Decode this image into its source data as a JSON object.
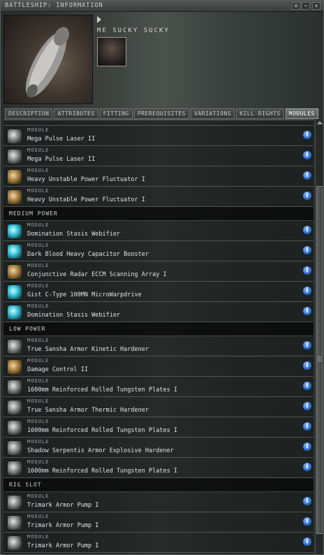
{
  "window": {
    "title": "BATTLESHIP: INFORMATION",
    "buttons": [
      "⊙",
      "−",
      "×"
    ]
  },
  "header": {
    "pilot_name": "ME SUCKY SUCKY"
  },
  "tabs": [
    {
      "label": "DESCRIPTION",
      "active": false
    },
    {
      "label": "ATTRIBUTES",
      "active": false
    },
    {
      "label": "FITTING",
      "active": false
    },
    {
      "label": "PREREQUISITES",
      "active": false
    },
    {
      "label": "VARIATIONS",
      "active": false
    },
    {
      "label": "KILL RIGHTS",
      "active": false
    },
    {
      "label": "MODULES",
      "active": true
    }
  ],
  "modules": {
    "kind_label": "MODULE",
    "info_glyph": "i",
    "high_power": [
      {
        "name": "Mega Pulse Laser II",
        "icon": "laser-icon"
      },
      {
        "name": "Mega Pulse Laser II",
        "icon": "laser-icon"
      },
      {
        "name": "Heavy Unstable Power Fluctuator I",
        "icon": "neut-icon"
      },
      {
        "name": "Heavy Unstable Power Fluctuator I",
        "icon": "neut-icon"
      }
    ],
    "medium_power_label": "MEDIUM POWER",
    "medium_power": [
      {
        "name": "Domination Stasis Webifier",
        "icon": "web-icon"
      },
      {
        "name": "Dark Blood Heavy Capacitor Booster",
        "icon": "capacitor-booster-icon"
      },
      {
        "name": "Conjunctive Radar ECCM Scanning Array I",
        "icon": "eccm-icon"
      },
      {
        "name": "Gist C-Type 100MN MicroWarpdrive",
        "icon": "mwd-icon"
      },
      {
        "name": "Domination Stasis Webifier",
        "icon": "web-icon"
      }
    ],
    "low_power_label": "LOW POWER",
    "low_power": [
      {
        "name": "True Sansha Armor Kinetic Hardener",
        "icon": "hardener-icon"
      },
      {
        "name": "Damage Control II",
        "icon": "damage-control-icon"
      },
      {
        "name": "1600mm Reinforced Rolled Tungsten Plates I",
        "icon": "armor-plate-icon"
      },
      {
        "name": "True Sansha Armor Thermic Hardener",
        "icon": "hardener-icon"
      },
      {
        "name": "1600mm Reinforced Rolled Tungsten Plates I",
        "icon": "armor-plate-icon"
      },
      {
        "name": "Shadow Serpentis Armor Explosive Hardener",
        "icon": "hardener-icon"
      },
      {
        "name": "1600mm Reinforced Rolled Tungsten Plates I",
        "icon": "armor-plate-icon"
      }
    ],
    "rig_slot_label": "RIG SLOT",
    "rig_slot": [
      {
        "name": "Trimark Armor Pump I",
        "icon": "rig-icon"
      },
      {
        "name": "Trimark Armor Pump I",
        "icon": "rig-icon"
      },
      {
        "name": "Trimark Armor Pump I",
        "icon": "rig-icon"
      }
    ]
  },
  "colors": {
    "accent": "#2c6fd8",
    "tab_active": "#6f7572"
  }
}
